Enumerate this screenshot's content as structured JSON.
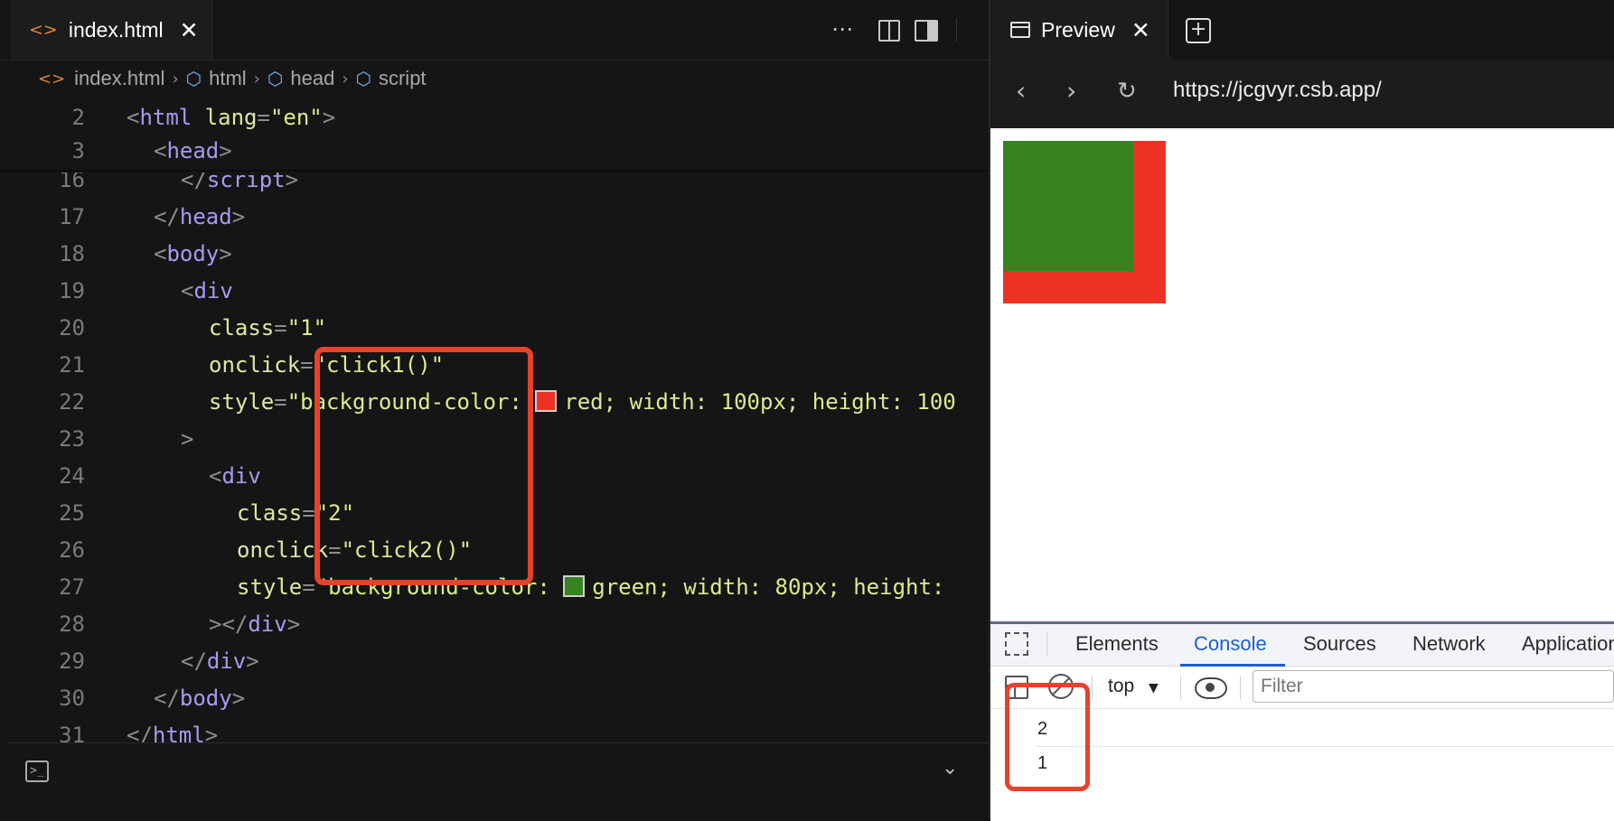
{
  "editor": {
    "tab": {
      "icon": "code-icon",
      "label": "index.html",
      "close": "✕"
    },
    "toolbar": {
      "toggle_sidebar": "toggle-panel-icon",
      "split": "split-editor-icon",
      "more": "⋯"
    },
    "breadcrumbs": [
      "index.html",
      "html",
      "head",
      "script"
    ],
    "lines": [
      {
        "num": "2"
      },
      {
        "num": "3"
      },
      {
        "num": "16"
      },
      {
        "num": "17"
      },
      {
        "num": "18"
      },
      {
        "num": "19"
      },
      {
        "num": "20"
      },
      {
        "num": "21"
      },
      {
        "num": "22"
      },
      {
        "num": "23"
      },
      {
        "num": "24"
      },
      {
        "num": "25"
      },
      {
        "num": "26"
      },
      {
        "num": "27"
      },
      {
        "num": "28"
      },
      {
        "num": "29"
      },
      {
        "num": "30"
      },
      {
        "num": "31"
      }
    ],
    "code": {
      "l2_tag": "html",
      "l2_attr": "lang",
      "l2_val": "\"en\"",
      "l3_tag": "head",
      "l16_tag": "script",
      "l17_tag": "head",
      "l18_tag": "body",
      "l19_tag": "div",
      "l20_attr": "class",
      "l20_val": "\"1\"",
      "l21_attr": "onclick",
      "l21_val": "\"click1()\"",
      "l22_attr": "style",
      "l22_val_a": "\"background-color: ",
      "l22_val_b": "red; width: 100px; height: 100",
      "l22_swatch": "#ed3224",
      "l23_text": ">",
      "l24_tag": "div",
      "l25_attr": "class",
      "l25_val": "\"2\"",
      "l26_attr": "onclick",
      "l26_val": "\"click2()\"",
      "l27_attr": "style",
      "l27_val_a": "\"background-color: ",
      "l27_val_b": "green; width: 80px; height: ",
      "l27_swatch": "#37831f",
      "l28_tag": "div",
      "l29_tag": "div",
      "l30_tag": "body",
      "l31_tag": "html"
    },
    "terminal": {
      "icon": "terminal-icon",
      "collapse": "chevron-down-icon"
    }
  },
  "preview": {
    "tab": {
      "label": "Preview",
      "close": "✕"
    },
    "new_tab": "+",
    "url": "https://jcgvyr.csb.app/",
    "boxes": {
      "outer_color": "#ed3224",
      "inner_color": "#37831f"
    }
  },
  "devtools": {
    "tabs": [
      "Elements",
      "Console",
      "Sources",
      "Network",
      "Application"
    ],
    "active_tab": "Console",
    "context": "top",
    "filter_placeholder": "Filter",
    "logs": [
      "2",
      "1"
    ]
  },
  "colors": {
    "annotation": "#e8412c",
    "accent": "#1a5fd1"
  }
}
